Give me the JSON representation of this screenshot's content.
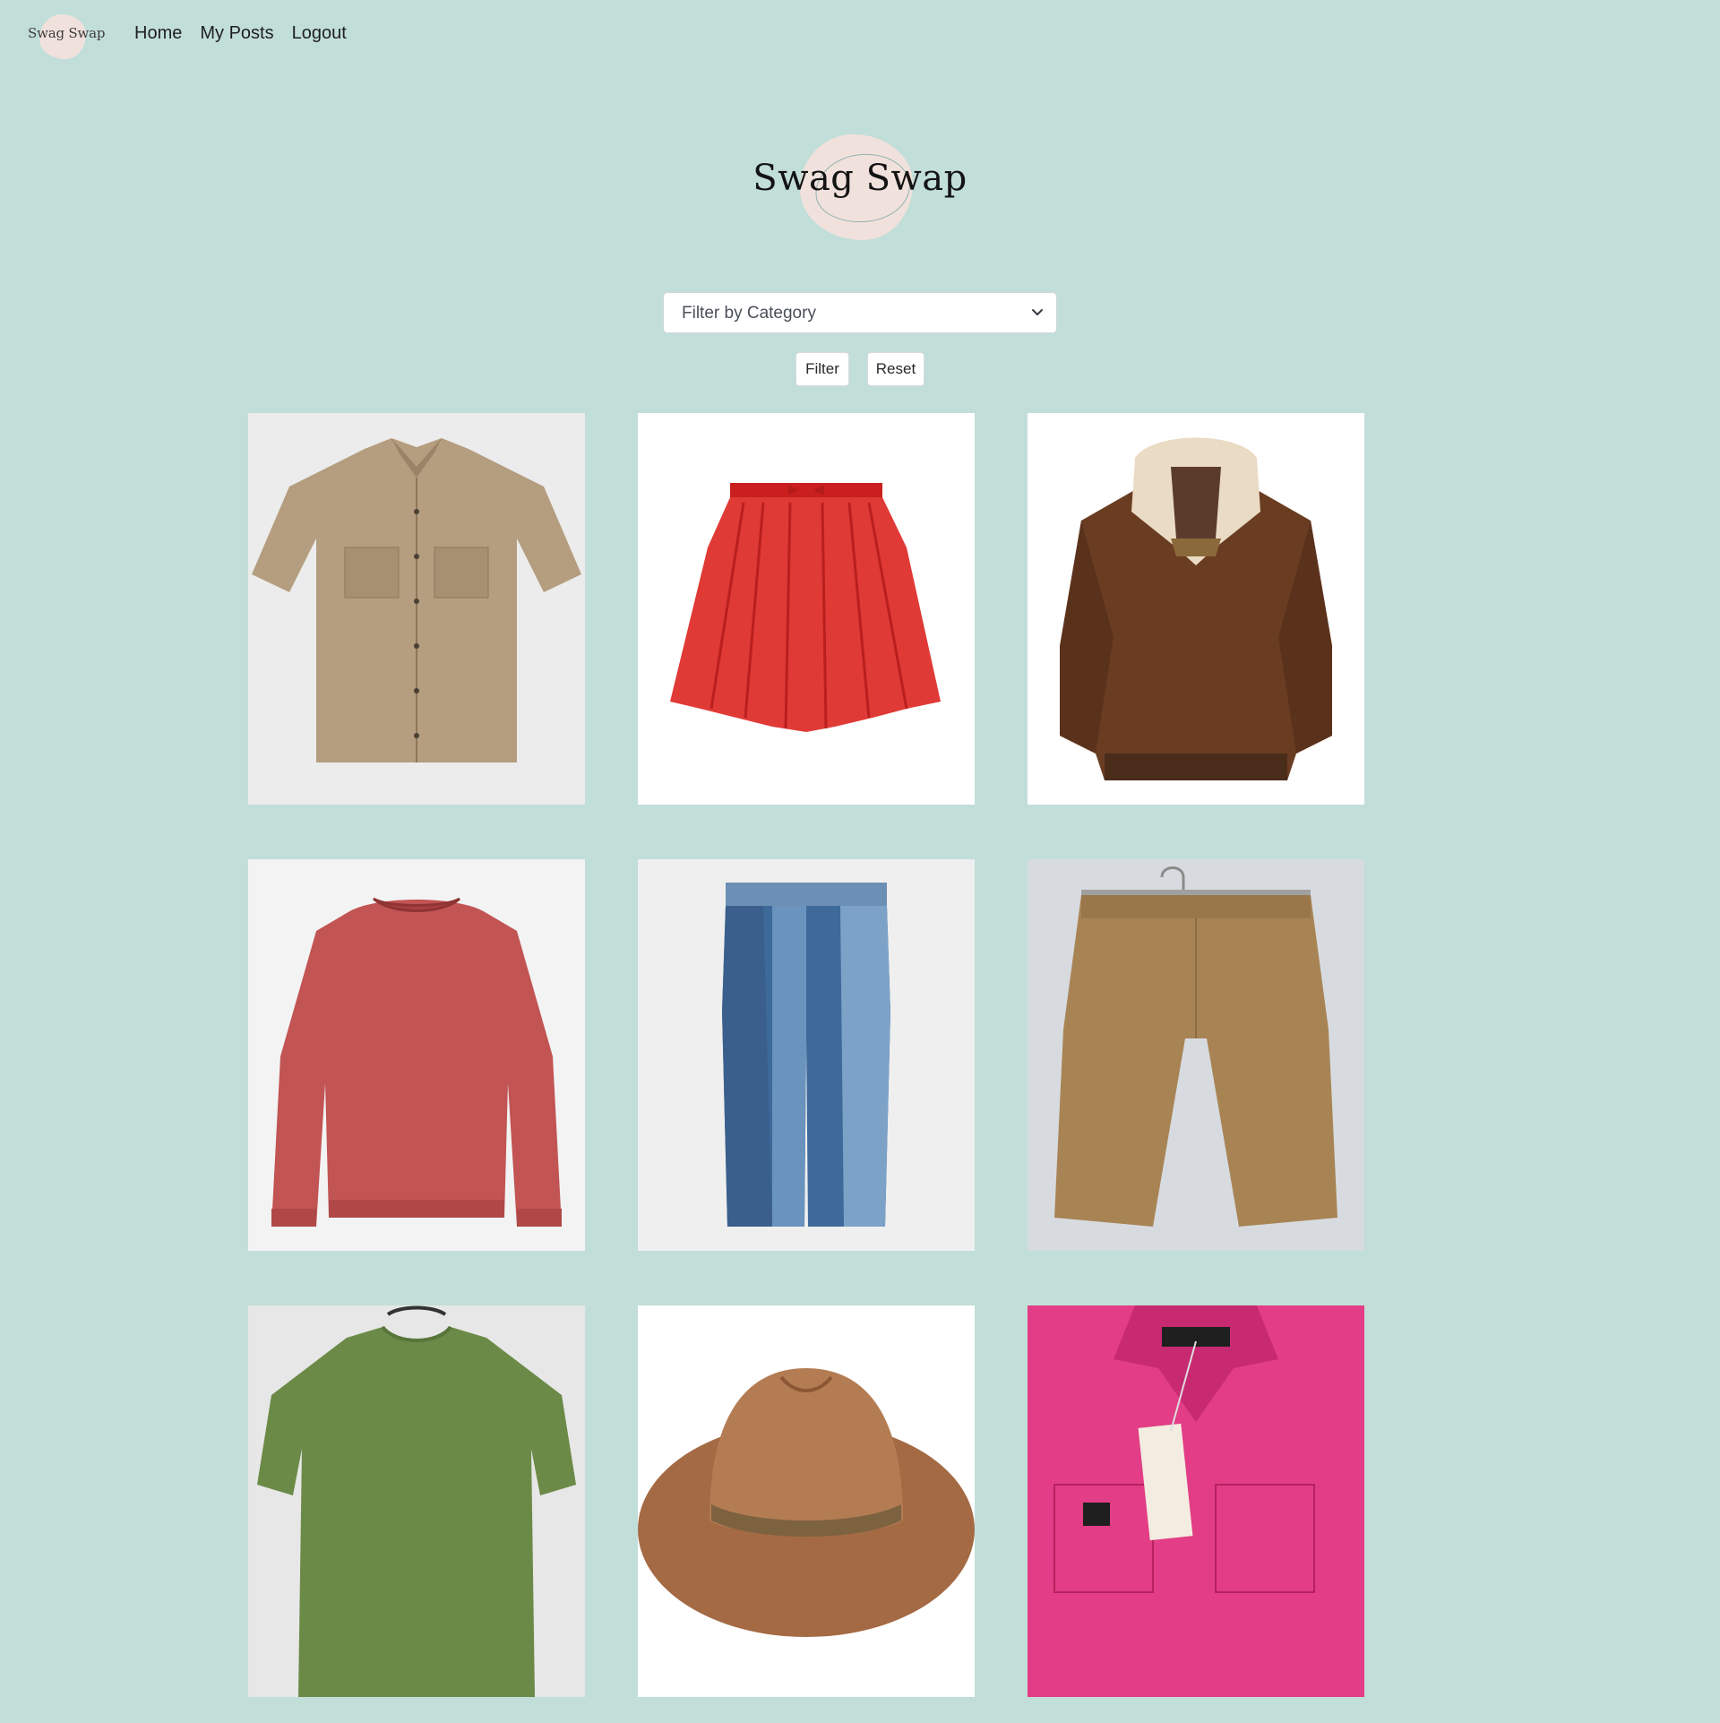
{
  "nav": {
    "logo_text": "Swag Swap",
    "links": [
      "Home",
      "My Posts",
      "Logout"
    ]
  },
  "hero": {
    "title": "Swag Swap"
  },
  "filter": {
    "select_value": "Filter by Category",
    "filter_label": "Filter",
    "reset_label": "Reset"
  },
  "colors": {
    "background": "#c2ded9",
    "blob": "#f1e1dc"
  },
  "items": [
    {
      "icon": "tan-short-sleeve-shirt-image"
    },
    {
      "icon": "red-skirt-image"
    },
    {
      "icon": "brown-leather-bomber-jacket-image"
    },
    {
      "icon": "red-long-sleeve-sweater-image"
    },
    {
      "icon": "two-tone-denim-jeans-image"
    },
    {
      "icon": "khaki-linen-pants-image"
    },
    {
      "icon": "olive-green-tshirt-image"
    },
    {
      "icon": "brown-felt-hat-image"
    },
    {
      "icon": "pink-overshirt-image"
    }
  ]
}
